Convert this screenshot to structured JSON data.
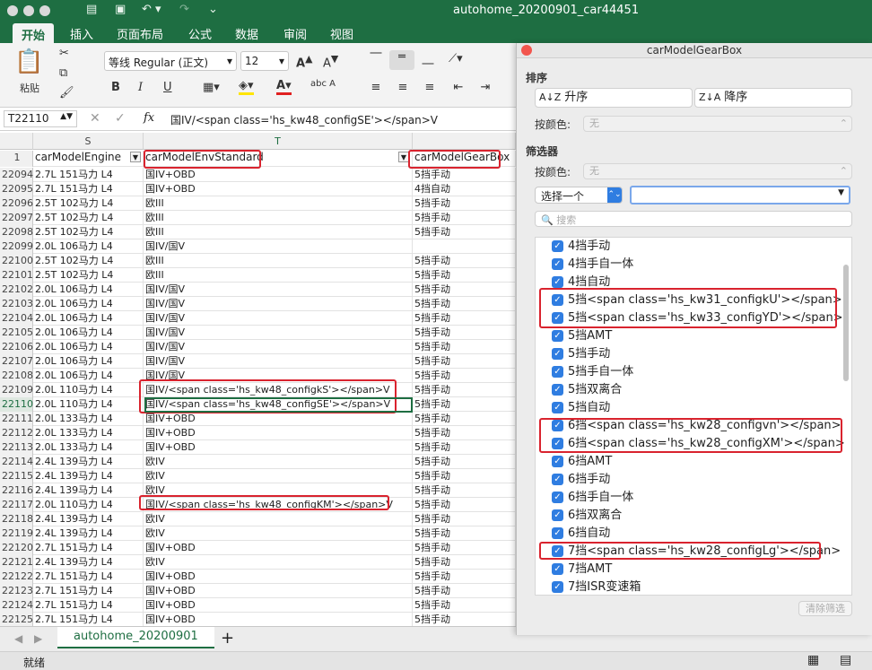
{
  "window": {
    "title": "autohome_20200901_car44451"
  },
  "ribbon_tabs": [
    "开始",
    "插入",
    "页面布局",
    "公式",
    "数据",
    "审阅",
    "视图"
  ],
  "ribbon": {
    "paste_label": "粘贴",
    "font_name": "等线 Regular (正文)",
    "font_size": "12",
    "font_grow": "A",
    "font_shrink": "A",
    "bold": "B",
    "italic": "I",
    "underline": "U",
    "font_color": "A",
    "phonetic": "abc"
  },
  "formula_bar": {
    "cell_ref": "T22110",
    "fx": "fx",
    "value": "国IV/<span class='hs_kw48_configSE'></span>V"
  },
  "columns": {
    "S": "S",
    "T": "T"
  },
  "header_row": {
    "num": "1",
    "s": "carModelEngine",
    "t": "carModelEnvStandard",
    "u": "carModelGearBox"
  },
  "rows": [
    {
      "n": "22094",
      "s": "2.7L 151马力 L4",
      "t": "国IV+OBD",
      "u": "5挡手动"
    },
    {
      "n": "22095",
      "s": "2.7L 151马力 L4",
      "t": "国IV+OBD",
      "u": "4挡自动"
    },
    {
      "n": "22096",
      "s": "2.5T 102马力 L4",
      "t": "欧III",
      "u": "5挡手动"
    },
    {
      "n": "22097",
      "s": "2.5T 102马力 L4",
      "t": "欧III",
      "u": "5挡手动"
    },
    {
      "n": "22098",
      "s": "2.5T 102马力 L4",
      "t": "欧III",
      "u": "5挡手动"
    },
    {
      "n": "22099",
      "s": "2.0L 106马力 L4",
      "t": "国IV/国V",
      "u": ""
    },
    {
      "n": "22100",
      "s": "2.5T 102马力 L4",
      "t": "欧III",
      "u": "5挡手动"
    },
    {
      "n": "22101",
      "s": "2.5T 102马力 L4",
      "t": "欧III",
      "u": "5挡手动"
    },
    {
      "n": "22102",
      "s": "2.0L 106马力 L4",
      "t": "国IV/国V",
      "u": "5挡手动"
    },
    {
      "n": "22103",
      "s": "2.0L 106马力 L4",
      "t": "国IV/国V",
      "u": "5挡手动"
    },
    {
      "n": "22104",
      "s": "2.0L 106马力 L4",
      "t": "国IV/国V",
      "u": "5挡手动"
    },
    {
      "n": "22105",
      "s": "2.0L 106马力 L4",
      "t": "国IV/国V",
      "u": "5挡手动"
    },
    {
      "n": "22106",
      "s": "2.0L 106马力 L4",
      "t": "国IV/国V",
      "u": "5挡手动"
    },
    {
      "n": "22107",
      "s": "2.0L 106马力 L4",
      "t": "国IV/国V",
      "u": "5挡手动"
    },
    {
      "n": "22108",
      "s": "2.0L 106马力 L4",
      "t": "国IV/国V",
      "u": "5挡手动"
    },
    {
      "n": "22109",
      "s": "2.0L 110马力 L4",
      "t": "国IV/<span class='hs_kw48_configkS'></span>V",
      "u": "5挡手动"
    },
    {
      "n": "22110",
      "s": "2.0L 110马力 L4",
      "t": "国IV/<span class='hs_kw48_configSE'></span>V",
      "u": "5挡手动"
    },
    {
      "n": "22111",
      "s": "2.0L 133马力 L4",
      "t": "国IV+OBD",
      "u": "5挡手动"
    },
    {
      "n": "22112",
      "s": "2.0L 133马力 L4",
      "t": "国IV+OBD",
      "u": "5挡手动"
    },
    {
      "n": "22113",
      "s": "2.0L 133马力 L4",
      "t": "国IV+OBD",
      "u": "5挡手动"
    },
    {
      "n": "22114",
      "s": "2.4L 139马力 L4",
      "t": "欧IV",
      "u": "5挡手动"
    },
    {
      "n": "22115",
      "s": "2.4L 139马力 L4",
      "t": "欧IV",
      "u": "5挡手动"
    },
    {
      "n": "22116",
      "s": "2.4L 139马力 L4",
      "t": "欧IV",
      "u": "5挡手动"
    },
    {
      "n": "22117",
      "s": "2.0L 110马力 L4",
      "t": "国IV/<span class='hs_kw48_configKM'></span>V",
      "u": "5挡手动"
    },
    {
      "n": "22118",
      "s": "2.4L 139马力 L4",
      "t": "欧IV",
      "u": "5挡手动"
    },
    {
      "n": "22119",
      "s": "2.4L 139马力 L4",
      "t": "欧IV",
      "u": "5挡手动"
    },
    {
      "n": "22120",
      "s": "2.7L 151马力 L4",
      "t": "国IV+OBD",
      "u": "5挡手动"
    },
    {
      "n": "22121",
      "s": "2.4L 139马力 L4",
      "t": "欧IV",
      "u": "5挡手动"
    },
    {
      "n": "22122",
      "s": "2.7L 151马力 L4",
      "t": "国IV+OBD",
      "u": "5挡手动"
    },
    {
      "n": "22123",
      "s": "2.7L 151马力 L4",
      "t": "国IV+OBD",
      "u": "5挡手动"
    },
    {
      "n": "22124",
      "s": "2.7L 151马力 L4",
      "t": "国IV+OBD",
      "u": "5挡手动"
    },
    {
      "n": "22125",
      "s": "2.7L 151马力 L4",
      "t": "国IV+OBD",
      "u": "5挡手动"
    }
  ],
  "sheet_tab": "autohome_20200901",
  "status": "就绪",
  "panel": {
    "title": "carModelGearBox",
    "sort_label": "排序",
    "asc": "升序",
    "desc": "降序",
    "by_color": "按颜色:",
    "none": "无",
    "filter_label": "筛选器",
    "choose_one": "选择一个",
    "search_placeholder": "搜索",
    "clear_filter": "清除筛选",
    "items": [
      "4挡手动",
      "4挡手自一体",
      "4挡自动",
      "5挡<span class='hs_kw31_configkU'></span>",
      "5挡<span class='hs_kw33_configYD'></span>",
      "5挡AMT",
      "5挡手动",
      "5挡手自一体",
      "5挡双离合",
      "5挡自动",
      "6挡<span class='hs_kw28_configvn'></span>",
      "6挡<span class='hs_kw28_configXM'></span>",
      "6挡AMT",
      "6挡手动",
      "6挡手自一体",
      "6挡双离合",
      "6挡自动",
      "7挡<span class='hs_kw28_configLg'></span>",
      "7挡AMT",
      "7挡ISR变速箱"
    ]
  },
  "accent": "#1e6e42",
  "highlight": "#d9232e"
}
